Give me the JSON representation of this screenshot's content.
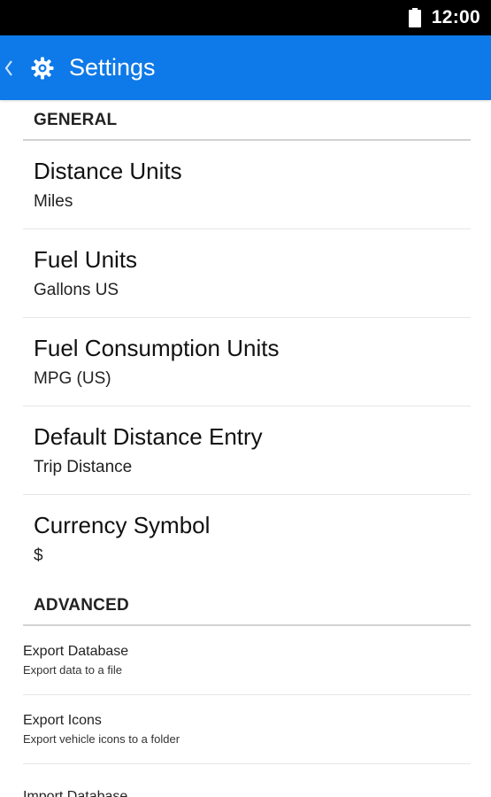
{
  "status_bar": {
    "time": "12:00",
    "battery_icon": "battery-full-icon"
  },
  "app_bar": {
    "title": "Settings",
    "back_icon": "chevron-left-icon",
    "settings_icon": "gear-icon",
    "color": "#0e79e8"
  },
  "general": {
    "header": "GENERAL",
    "items": [
      {
        "title": "Distance Units",
        "summary": "Miles"
      },
      {
        "title": "Fuel Units",
        "summary": "Gallons US"
      },
      {
        "title": "Fuel Consumption Units",
        "summary": "MPG (US)"
      },
      {
        "title": "Default Distance Entry",
        "summary": "Trip Distance"
      },
      {
        "title": "Currency Symbol",
        "summary": "$"
      }
    ]
  },
  "advanced": {
    "header": "ADVANCED",
    "items": [
      {
        "title": "Export Database",
        "summary": "Export data to a file"
      },
      {
        "title": "Export Icons",
        "summary": "Export vehicle icons to a folder"
      },
      {
        "title": "Import Database",
        "summary": ""
      }
    ]
  }
}
